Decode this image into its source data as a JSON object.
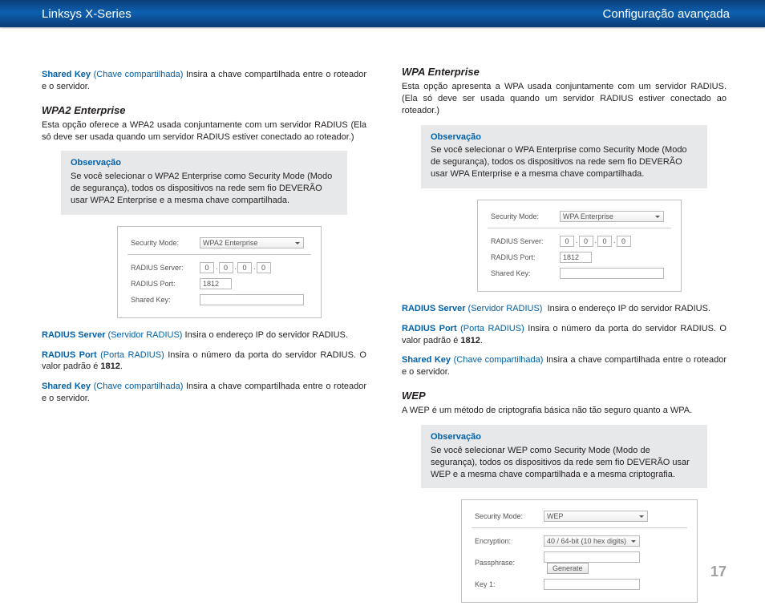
{
  "header": {
    "left": "Linksys X-Series",
    "right": "Configuração avançada"
  },
  "page_number": "17",
  "labels": {
    "radius_server": "RADIUS Server",
    "radius_server_tr": "(Servidor RADIUS)",
    "radius_port": "RADIUS Port",
    "radius_port_tr": "(Porta RADIUS)",
    "shared_key": "Shared Key",
    "shared_key_tr": "(Chave compartilhada)",
    "note_title": "Observação"
  },
  "left_col": {
    "intro_shared": "Insira a chave compartilhada entre o roteador e o servidor.",
    "wpa2e_heading": "WPA2 Enterprise",
    "wpa2e_desc": "Esta opção oferece a WPA2 usada conjuntamente com um servidor RADIUS (Ela só deve ser usada quando um servidor RADIUS estiver conectado ao roteador.)",
    "wpa2e_note": "Se você selecionar o WPA2 Enterprise como Security Mode (Modo de segurança), todos os dispositivos na rede sem fio DEVERÃO usar WPA2 Enterprise e a mesma chave compartilhada.",
    "shot": {
      "security_mode_l": "Security Mode:",
      "security_mode_v": "WPA2 Enterprise",
      "radius_server_l": "RADIUS Server:",
      "ip": [
        "0",
        "0",
        "0",
        "0"
      ],
      "radius_port_l": "RADIUS Port:",
      "radius_port_v": "1812",
      "shared_key_l": "Shared Key:"
    },
    "radius_server_text": "Insira o endereço IP do servidor RADIUS.",
    "radius_port_text_a": "Insira o número da porta do servidor RADIUS. O valor padrão é ",
    "radius_port_bold": "1812",
    "radius_port_text_b": ".",
    "shared_key_text": "Insira a chave compartilhada entre o roteador e o servidor."
  },
  "right_col": {
    "wpae_heading": "WPA Enterprise",
    "wpae_desc": "Esta opção apresenta a WPA usada conjuntamente com um servidor RADIUS. (Ela só deve ser usada quando um servidor RADIUS estiver conectado ao roteador.)",
    "wpae_note": "Se você selecionar o WPA Enterprise como Security Mode (Modo de segurança), todos os dispositivos na rede sem fio DEVERÃO usar WPA Enterprise e a mesma chave compartilhada.",
    "shot1": {
      "security_mode_l": "Security Mode:",
      "security_mode_v": "WPA Enterprise",
      "radius_server_l": "RADIUS Server:",
      "ip": [
        "0",
        "0",
        "0",
        "0"
      ],
      "radius_port_l": "RADIUS Port:",
      "radius_port_v": "1812",
      "shared_key_l": "Shared Key:"
    },
    "radius_server_text": "Insira o endereço IP do servidor RADIUS.",
    "radius_port_text_a": "Insira o número da porta do servidor RADIUS. O valor padrão é ",
    "radius_port_bold": "1812",
    "radius_port_text_b": ".",
    "shared_key_text": "Insira a chave compartilhada entre o roteador e o servidor.",
    "wep_heading": "WEP",
    "wep_desc": "A WEP é um método de criptografia básica não tão seguro quanto a WPA.",
    "wep_note": "Se você selecionar WEP como Security Mode (Modo de segurança), todos os dispositivos da rede sem fio DEVERÃO usar WEP e a mesma chave compartilhada e a mesma criptografia.",
    "shot2": {
      "security_mode_l": "Security Mode:",
      "security_mode_v": "WEP",
      "encryption_l": "Encryption:",
      "encryption_v": "40 / 64-bit (10 hex digits)",
      "passphrase_l": "Passphrase:",
      "generate_btn": "Generate",
      "key1_l": "Key 1:"
    }
  }
}
